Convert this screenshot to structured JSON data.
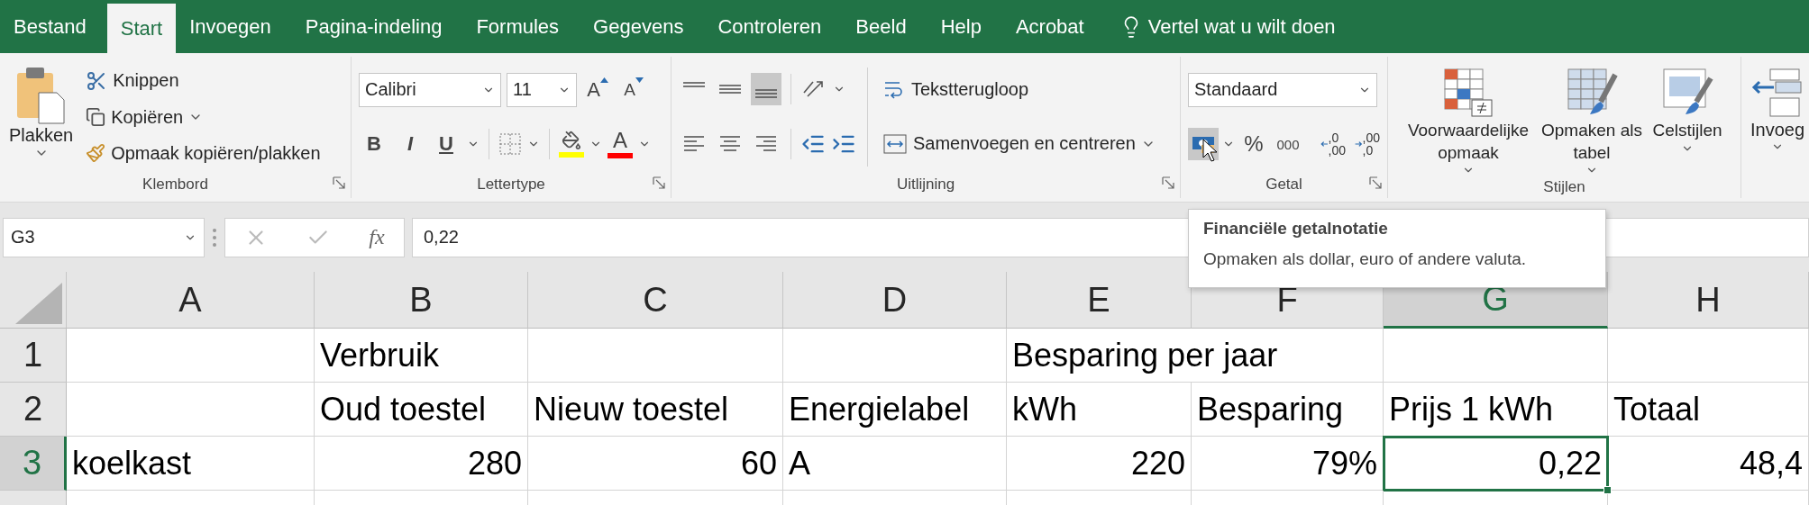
{
  "tabs": [
    {
      "label": "Bestand",
      "selected": false
    },
    {
      "label": "Start",
      "selected": true
    },
    {
      "label": "Invoegen",
      "selected": false
    },
    {
      "label": "Pagina-indeling",
      "selected": false
    },
    {
      "label": "Formules",
      "selected": false
    },
    {
      "label": "Gegevens",
      "selected": false
    },
    {
      "label": "Controleren",
      "selected": false
    },
    {
      "label": "Beeld",
      "selected": false
    },
    {
      "label": "Help",
      "selected": false
    },
    {
      "label": "Acrobat",
      "selected": false
    }
  ],
  "tell_me": "Vertel wat u wilt doen",
  "ribbon": {
    "clipboard": {
      "paste": "Plakken",
      "cut": "Knippen",
      "copy": "Kopiëren",
      "format_painter": "Opmaak kopiëren/plakken",
      "label": "Klembord"
    },
    "font": {
      "name": "Calibri",
      "size": "11",
      "grow": "A",
      "shrink": "A",
      "bold": "B",
      "italic": "I",
      "underline": "U",
      "font_color": "A",
      "label": "Lettertype"
    },
    "alignment": {
      "vertical": [
        {
          "kind": "top",
          "selected": false
        },
        {
          "kind": "middle",
          "selected": false
        },
        {
          "kind": "bottom",
          "selected": true
        }
      ],
      "wrap": "Tekstterugloop",
      "merge": "Samenvoegen en centreren",
      "label": "Uitlijning"
    },
    "number": {
      "format": "Standaard",
      "accounting_pressed": true,
      "percent": "%",
      "thousands": "000",
      "decimals": [
        {
          "top": ",0",
          "bottom": ",00"
        },
        {
          "top": ",00",
          "bottom": ",0"
        }
      ],
      "label": "Getal"
    },
    "styles": {
      "buttons": [
        {
          "kind": "conditional",
          "label": "Voorwaardelijke opmaak"
        },
        {
          "kind": "table",
          "label": "Opmaken als tabel"
        },
        {
          "kind": "cell",
          "label": "Celstijlen"
        }
      ],
      "label": "Stijlen"
    },
    "insert": {
      "label": "Invoeg"
    }
  },
  "formula_bar": {
    "name_box": "G3",
    "fx": "fx",
    "value": "0,22"
  },
  "tooltip": {
    "title": "Financiële getalnotatie",
    "text": "Opmaken als dollar, euro of andere valuta."
  },
  "sheet": {
    "columns": [
      {
        "label": "A",
        "selected": false
      },
      {
        "label": "B",
        "selected": false
      },
      {
        "label": "C",
        "selected": false
      },
      {
        "label": "D",
        "selected": false
      },
      {
        "label": "E",
        "selected": false
      },
      {
        "label": "F",
        "selected": false
      },
      {
        "label": "G",
        "selected": true
      },
      {
        "label": "H",
        "selected": false
      }
    ],
    "rows": [
      {
        "label": "1",
        "selected": false,
        "cells": [
          {
            "selected": false
          },
          {
            "text": "Verbruik",
            "kind": "text",
            "selected": false
          },
          {
            "selected": false
          },
          {
            "selected": false
          },
          {
            "text": "Besparing per jaar",
            "kind": "text",
            "selected": false
          },
          {
            "selected": false
          },
          {
            "selected": false
          },
          {
            "selected": false
          }
        ]
      },
      {
        "label": "2",
        "selected": false,
        "cells": [
          {
            "selected": false
          },
          {
            "text": "Oud toestel",
            "kind": "text",
            "selected": false
          },
          {
            "text": "Nieuw toestel",
            "kind": "text",
            "selected": false
          },
          {
            "text": "Energielabel",
            "kind": "text",
            "selected": false
          },
          {
            "text": "kWh",
            "kind": "text",
            "selected": false
          },
          {
            "text": "Besparing",
            "kind": "text",
            "selected": false
          },
          {
            "text": "Prijs 1 kWh",
            "kind": "text",
            "selected": false
          },
          {
            "text": "Totaal",
            "kind": "text",
            "selected": false
          }
        ]
      },
      {
        "label": "3",
        "selected": true,
        "cells": [
          {
            "text": "koelkast",
            "kind": "text",
            "selected": false
          },
          {
            "text": "280",
            "kind": "number",
            "selected": false
          },
          {
            "text": "60",
            "kind": "number",
            "selected": false
          },
          {
            "text": "A",
            "kind": "text",
            "selected": false
          },
          {
            "text": "220",
            "kind": "number",
            "selected": false
          },
          {
            "text": "79%",
            "kind": "number",
            "selected": false
          },
          {
            "text": "0,22",
            "kind": "number",
            "selected": true
          },
          {
            "text": "48,4",
            "kind": "number",
            "selected": false
          }
        ]
      }
    ]
  }
}
